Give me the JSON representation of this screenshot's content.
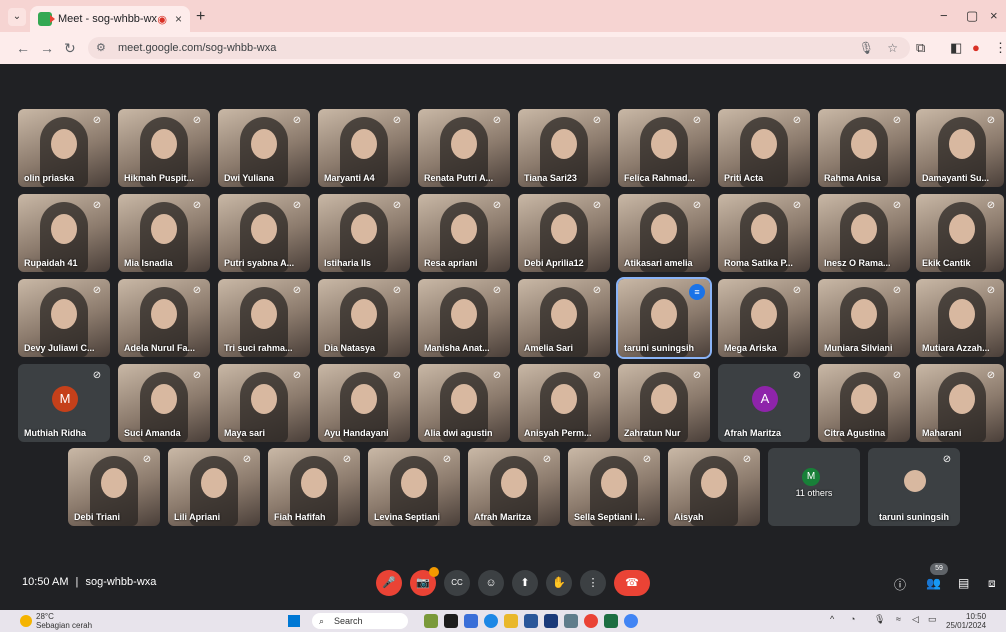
{
  "browser": {
    "tab_title": "Meet - sog-whbb-wxa",
    "tab_close": "×",
    "new_tab": "+",
    "url": "meet.google.com/sog-whbb-wxa",
    "window_controls": [
      "−",
      "▢",
      "×"
    ]
  },
  "participants_row1": [
    {
      "name": "olin priaska"
    },
    {
      "name": "Hikmah Puspit..."
    },
    {
      "name": "Dwi Yuliana"
    },
    {
      "name": "Maryanti A4"
    },
    {
      "name": "Renata Putri A..."
    },
    {
      "name": "Tiana Sari23"
    },
    {
      "name": "Felica Rahmad..."
    },
    {
      "name": "Priti Acta"
    },
    {
      "name": "Rahma Anisa"
    },
    {
      "name": "Damayanti Su..."
    }
  ],
  "participants_row2": [
    {
      "name": "Rupaidah 41"
    },
    {
      "name": "Mia Isnadia"
    },
    {
      "name": "Putri syabna A..."
    },
    {
      "name": "Istiharia Ils"
    },
    {
      "name": "Resa apriani"
    },
    {
      "name": "Debi Aprilia12"
    },
    {
      "name": "Atikasari amelia"
    },
    {
      "name": "Roma Satika P..."
    },
    {
      "name": "Inesz O Rama..."
    },
    {
      "name": "Ekik Cantik"
    }
  ],
  "participants_row3": [
    {
      "name": "Devy Juliawi C..."
    },
    {
      "name": "Adela Nurul Fa..."
    },
    {
      "name": "Tri suci rahma..."
    },
    {
      "name": "Dia Natasya"
    },
    {
      "name": "Manisha Anat..."
    },
    {
      "name": "Amelia Sari"
    },
    {
      "name": "taruni suningsih"
    },
    {
      "name": "Mega Ariska"
    },
    {
      "name": "Muniara Silviani"
    },
    {
      "name": "Mutiara Azzah..."
    }
  ],
  "participants_row4": [
    {
      "name": "Muthiah Ridha",
      "avatar": "M",
      "avatar_color": "#c5401a"
    },
    {
      "name": "Suci Amanda"
    },
    {
      "name": "Maya sari"
    },
    {
      "name": "Ayu Handayani"
    },
    {
      "name": "Alia dwi agustin"
    },
    {
      "name": "Anisyah Perm..."
    },
    {
      "name": "Zahratun Nur"
    },
    {
      "name": "Afrah Maritza",
      "avatar": "A",
      "avatar_color": "#8e24aa"
    },
    {
      "name": "Citra Agustina"
    },
    {
      "name": "Maharani"
    }
  ],
  "participants_row5": [
    {
      "name": "Debi Triani"
    },
    {
      "name": "Lili Apriani"
    },
    {
      "name": "Fiah Hafifah"
    },
    {
      "name": "Levina Septiani"
    },
    {
      "name": "Afrah Maritza"
    },
    {
      "name": "Sella Septiani I..."
    },
    {
      "name": "Aisyah"
    },
    {
      "name": "11 others",
      "avatar": "M",
      "avatar_color": "#188038"
    },
    {
      "name": "taruni suningsih"
    }
  ],
  "meeting": {
    "time": "10:50 AM",
    "separator": "|",
    "code": "sog-whbb-wxa",
    "participant_count": "59"
  },
  "controls": {
    "mic": "🎤",
    "camera": "📷",
    "captions": "CC",
    "emoji": "☺",
    "present": "⬆",
    "raise_hand": "✋",
    "more": "⋮",
    "end_call": "☎"
  },
  "taskbar": {
    "temperature": "28°C",
    "weather": "Sebagian cerah",
    "search": "Search",
    "time": "10:50",
    "date": "25/01/2024"
  },
  "colors": {
    "meet_bg": "#202124",
    "tab_bar": "#f6d4d2",
    "end_call": "#ea4335",
    "speaking_outline": "#8ab4f8"
  }
}
